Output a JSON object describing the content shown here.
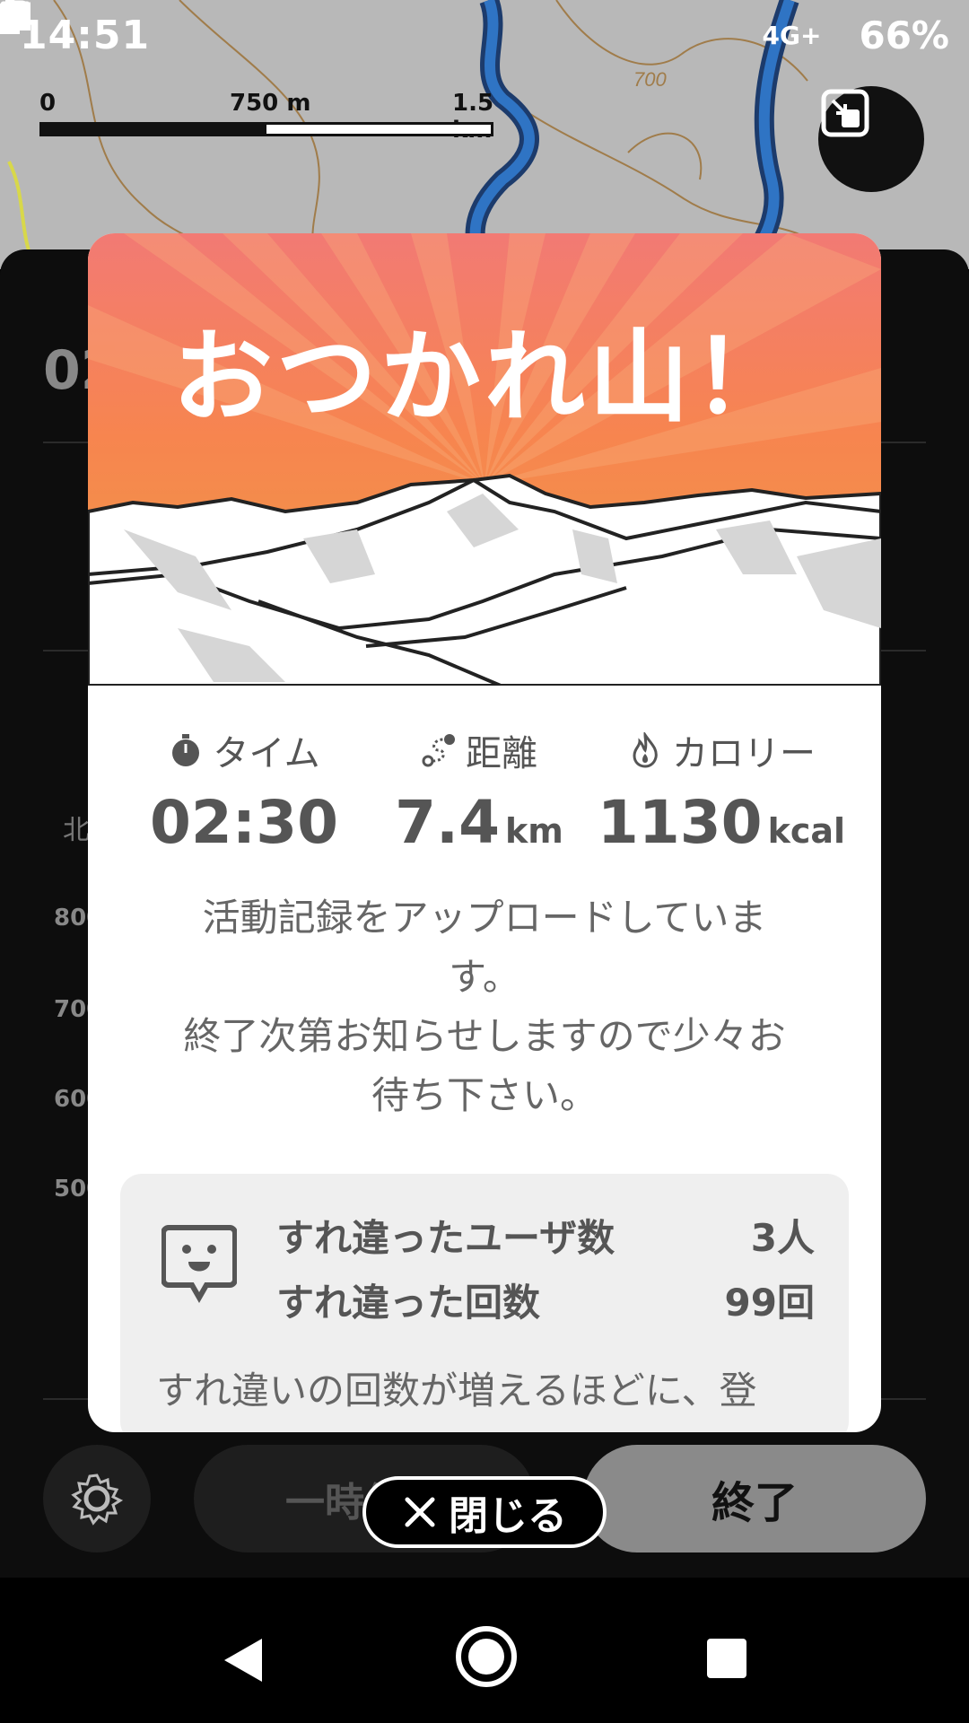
{
  "status_bar": {
    "time": "14:51",
    "network": "4G+",
    "battery": "66%",
    "icons": [
      "image-icon",
      "news-icon",
      "instagram-icon",
      "news-icon",
      "dot-icon",
      "location-icon",
      "signal-icon",
      "battery-icon"
    ]
  },
  "map": {
    "scale_labels": [
      "0",
      "750 m",
      "1.5 km"
    ],
    "contour_label": "700"
  },
  "background_panel": {
    "elapsed_partial": "02",
    "north_label": "北",
    "elevation_labels": [
      "800",
      "700",
      "600",
      "500"
    ],
    "pause_label": "一時停止",
    "end_label": "終了"
  },
  "dialog": {
    "title": "おつかれ山！",
    "stats": [
      {
        "icon": "stopwatch-icon",
        "label": "タイム",
        "value": "02:30",
        "unit": ""
      },
      {
        "icon": "route-icon",
        "label": "距離",
        "value": "7.4",
        "unit": "km"
      },
      {
        "icon": "flame-icon",
        "label": "カロリー",
        "value": "1130",
        "unit": "kcal"
      }
    ],
    "upload_message_line1": "活動記録をアップロードしていま",
    "upload_message_line2": "す。",
    "upload_message_line3": "終了次第お知らせしますので少々お",
    "upload_message_line4": "待ち下さい。",
    "passing": {
      "users_label": "すれ違ったユーザ数",
      "users_value": "3人",
      "count_label": "すれ違った回数",
      "count_value": "99回",
      "note": "すれ違いの回数が増えるほどに、登"
    }
  },
  "close_button": {
    "icon": "close-icon",
    "label": "閉じる"
  },
  "colors": {
    "hero_top": "#f27a74",
    "hero_bottom": "#f2904a",
    "route": "#1f5fa8",
    "end_button": "#8a8a8a"
  }
}
